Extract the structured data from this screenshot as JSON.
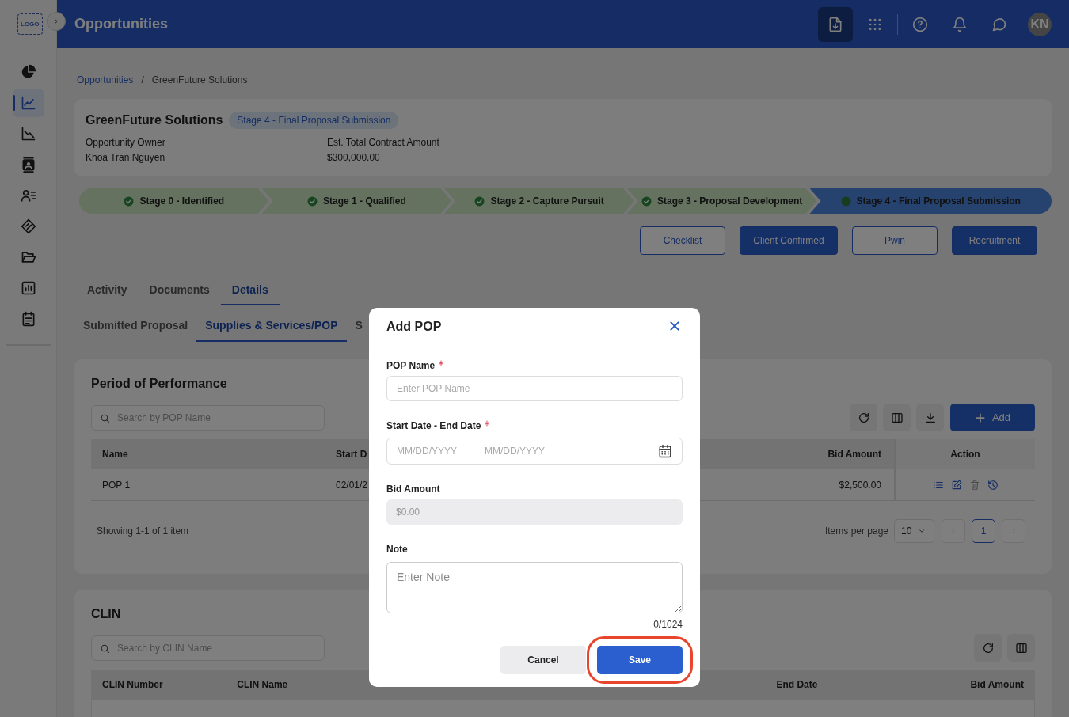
{
  "header": {
    "logo": "LOGO",
    "title": "Opportunities",
    "avatar": "KN"
  },
  "sidebar": {
    "items": [
      {
        "selected": false
      },
      {
        "selected": true
      },
      {
        "selected": false
      },
      {
        "selected": false
      },
      {
        "selected": false
      },
      {
        "selected": false
      },
      {
        "selected": false
      },
      {
        "selected": false
      },
      {
        "selected": false
      }
    ]
  },
  "breadcrumb": {
    "items": [
      "Opportunities",
      "GreenFuture Solutions"
    ],
    "separator": "/"
  },
  "opportunity": {
    "name": "GreenFuture Solutions",
    "stage_badge": "Stage 4 - Final Proposal Submission",
    "fields": [
      {
        "label": "Opportunity Owner",
        "value": "Khoa Tran Nguyen"
      },
      {
        "label": "Est. Total Contract Amount",
        "value": "$300,000.00"
      }
    ]
  },
  "stages": [
    {
      "label": "Stage 0 - Identified",
      "completed": true,
      "selected": false
    },
    {
      "label": "Stage 1 - Qualified",
      "completed": true,
      "selected": false
    },
    {
      "label": "Stage 2 - Capture Pursuit",
      "completed": true,
      "selected": false
    },
    {
      "label": "Stage 3 - Proposal Development",
      "completed": true,
      "selected": false
    },
    {
      "label": "Stage 4 - Final Proposal Submission",
      "completed": false,
      "selected": true
    }
  ],
  "actions": [
    {
      "label": "Checklist",
      "primary": false
    },
    {
      "label": "Client Confirmed",
      "primary": true
    },
    {
      "label": "Pwin",
      "primary": false
    },
    {
      "label": "Recruitment",
      "primary": true
    }
  ],
  "tabs": [
    {
      "label": "Activity",
      "selected": false
    },
    {
      "label": "Documents",
      "selected": false
    },
    {
      "label": "Details",
      "selected": true
    }
  ],
  "sub_tabs": [
    {
      "label": "Submitted Proposal",
      "selected": false
    },
    {
      "label": "Supplies & Services/POP",
      "selected": true
    },
    {
      "label": "S",
      "selected": false
    }
  ],
  "pop_section": {
    "title": "Period of Performance",
    "search_placeholder": "Search by POP Name",
    "add_button": "Add",
    "columns": [
      "Name",
      "Start D",
      "Bid Amount",
      "Action"
    ],
    "rows": [
      {
        "cells": [
          "POP 1",
          "02/01/2",
          "$2,500.00"
        ]
      }
    ],
    "footer": "Showing 1-1 of 1 item",
    "items_per_page_label": "Items per page",
    "page_size": "10",
    "pages": [
      {
        "label": "1",
        "selected": true
      }
    ]
  },
  "clin_section": {
    "title": "CLIN",
    "search_placeholder": "Search by CLIN Name",
    "columns": [
      "CLIN Number",
      "CLIN Name",
      "End Date",
      "Bid Amount"
    ]
  },
  "modal": {
    "title": "Add POP",
    "fields": [
      {
        "kind": "text",
        "label": "POP Name",
        "required": true,
        "placeholder": "Enter POP Name"
      },
      {
        "kind": "daterange",
        "label": "Start Date - End Date",
        "required": true,
        "placeholders": [
          "MM/DD/YYYY",
          "MM/DD/YYYY"
        ]
      },
      {
        "kind": "readonly",
        "label": "Bid Amount",
        "required": false,
        "value": "$0.00"
      },
      {
        "kind": "textarea",
        "label": "Note",
        "required": false,
        "placeholder": "Enter Note",
        "counter": "0/1024"
      }
    ],
    "buttons": [
      {
        "label": "Cancel",
        "primary": false,
        "highlighted": false
      },
      {
        "label": "Save",
        "primary": true,
        "highlighted": true
      }
    ]
  }
}
